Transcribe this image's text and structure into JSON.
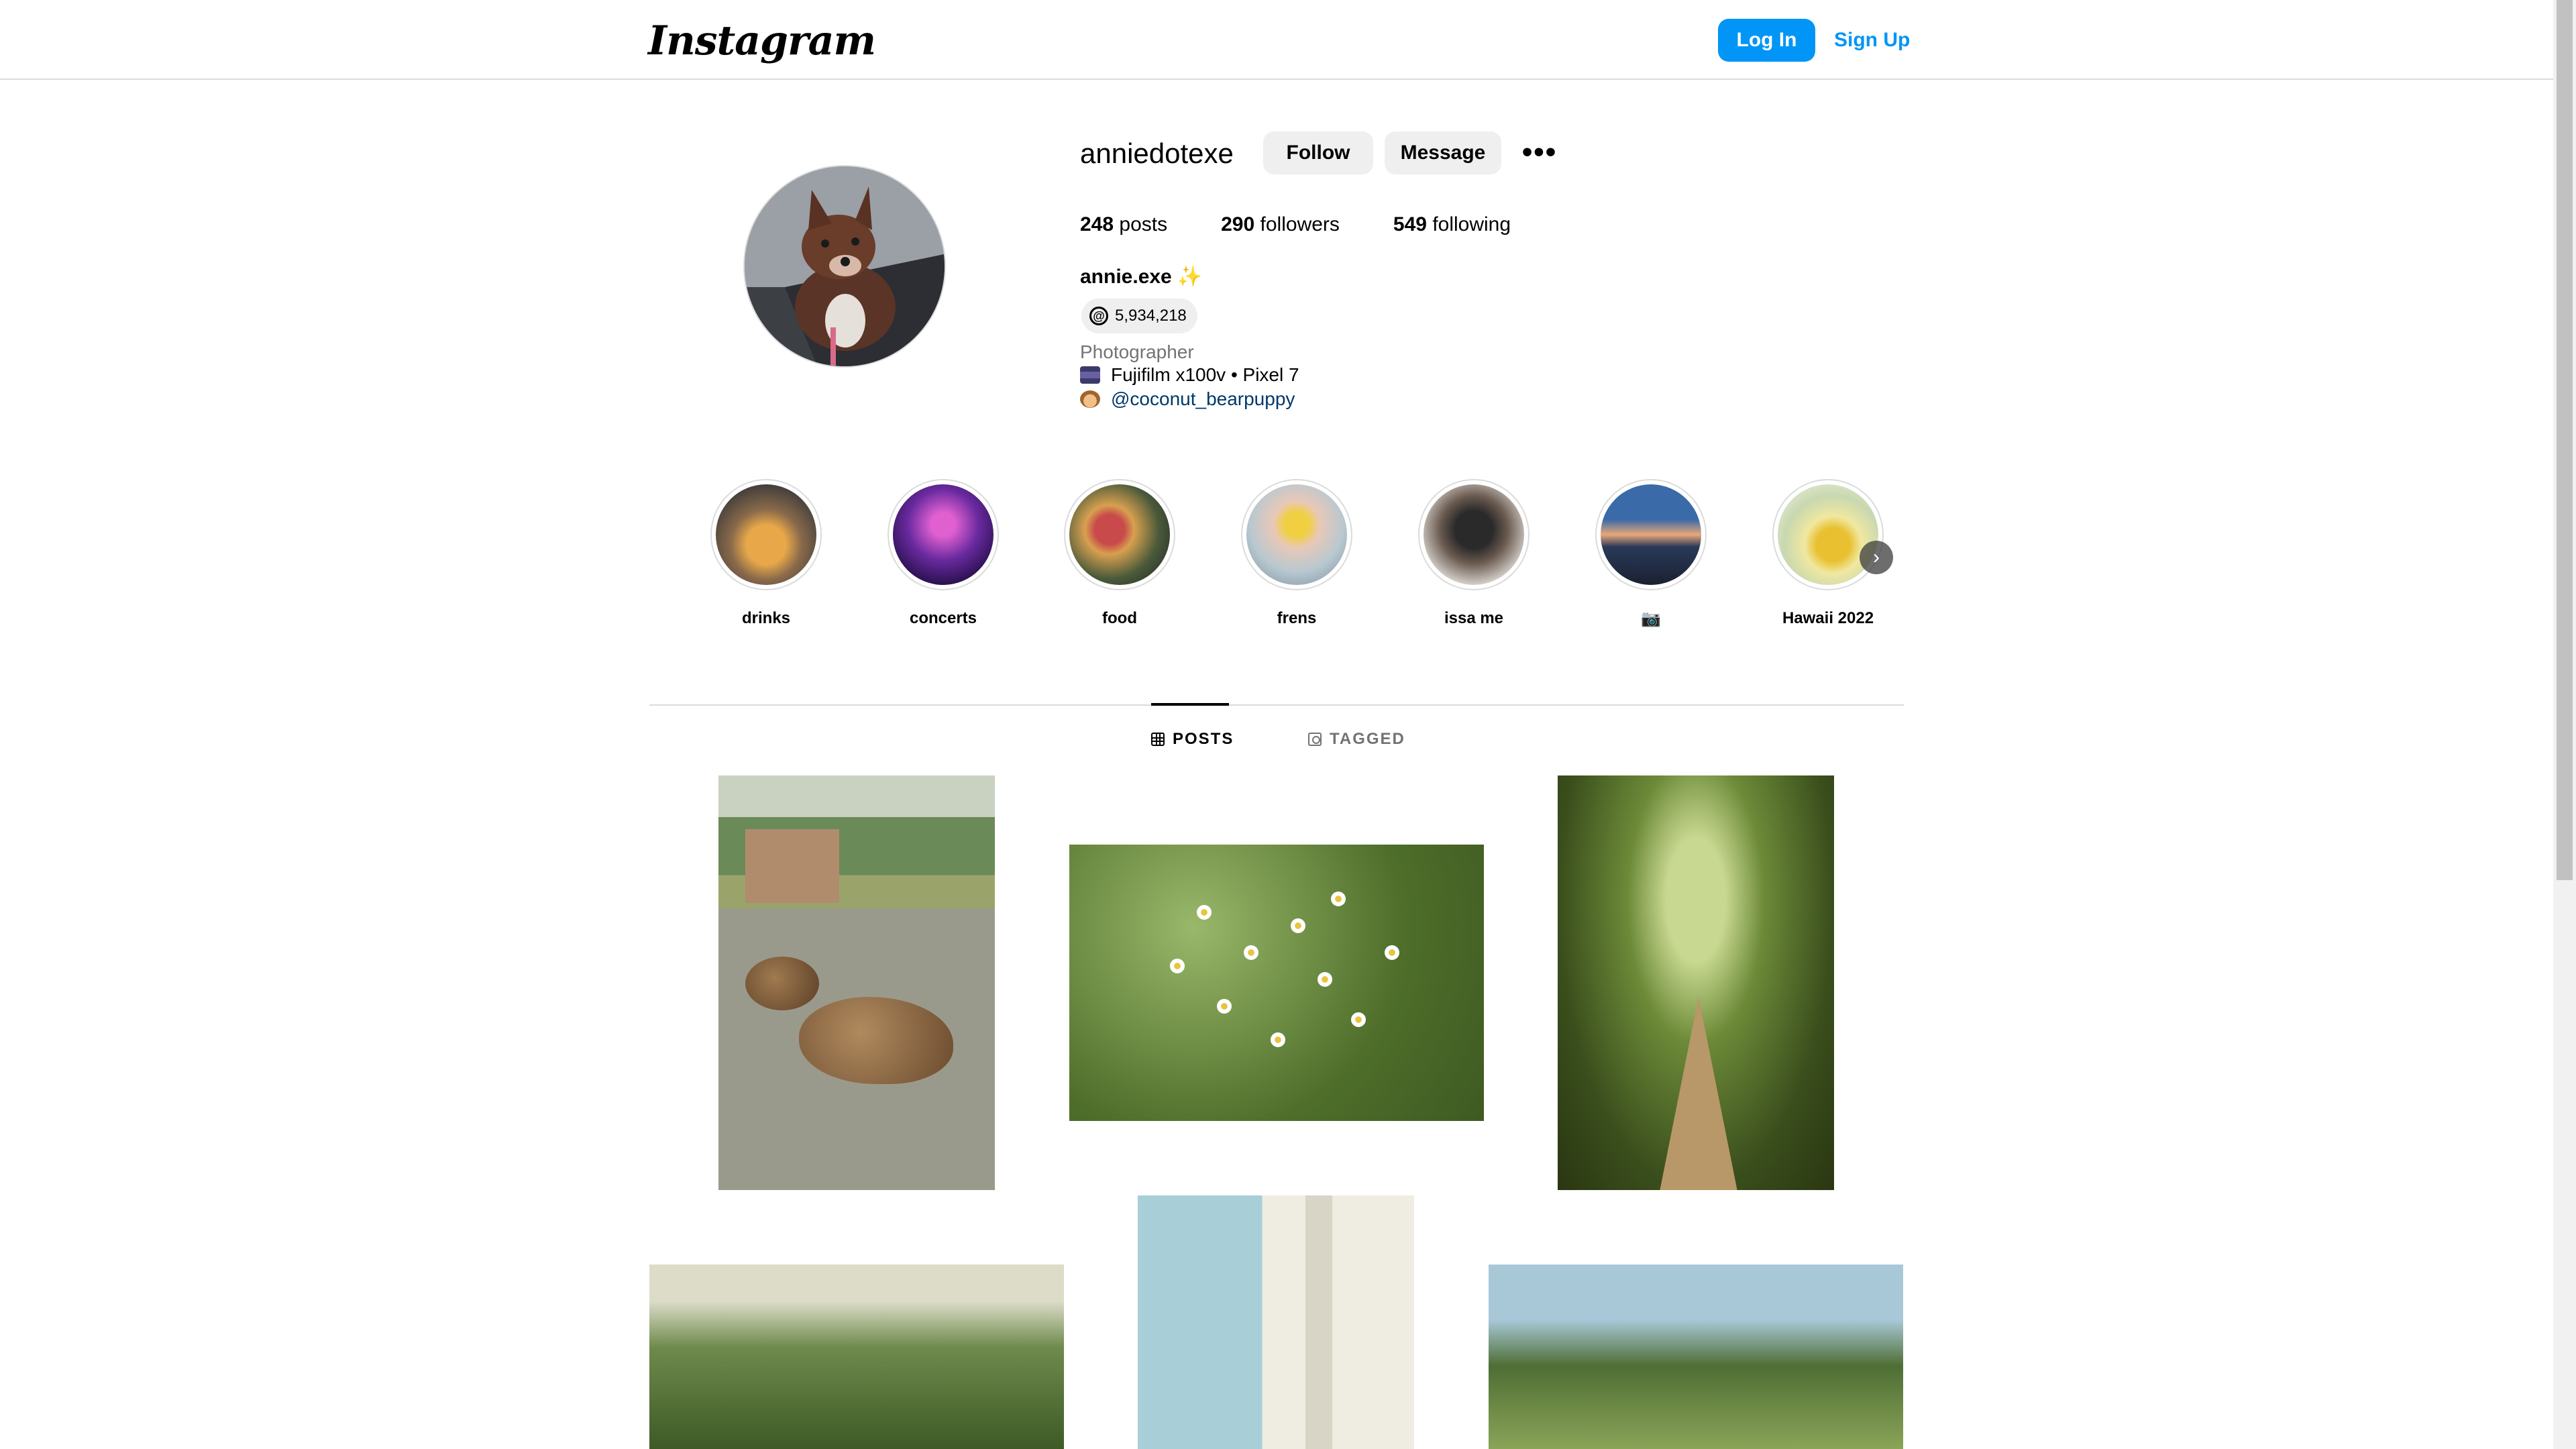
{
  "nav": {
    "logo_text": "Instagram",
    "login_label": "Log In",
    "signup_label": "Sign Up"
  },
  "profile": {
    "username": "anniedotexe",
    "follow_label": "Follow",
    "message_label": "Message",
    "more_label": "•••",
    "stats": {
      "posts_count": "248",
      "posts_label": "posts",
      "followers_count": "290",
      "followers_label": "followers",
      "following_count": "549",
      "following_label": "following"
    },
    "full_name": "annie.exe",
    "name_emoji": "✨",
    "threads_icon": "@",
    "threads_count": "5,934,218",
    "category": "Photographer",
    "bio_line_1": "Fujifilm x100v • Pixel 7",
    "bio_line_2_link": "@coconut_bearpuppy"
  },
  "highlights": [
    {
      "label": "drinks"
    },
    {
      "label": "concerts"
    },
    {
      "label": "food"
    },
    {
      "label": "frens"
    },
    {
      "label": "issa me"
    },
    {
      "label": "📷"
    },
    {
      "label": "Hawaii 2022"
    }
  ],
  "highlights_next_label": "›",
  "tabs": {
    "posts_label": "POSTS",
    "tagged_label": "TAGGED"
  },
  "colors": {
    "accent": "#0095f6",
    "link": "#00376b",
    "border": "#dbdbdb",
    "secondary_text": "#737373",
    "button_gray": "#efefef"
  },
  "icons": [
    "threads-icon",
    "more-options-icon",
    "grid-icon",
    "tag-icon",
    "chevron-right-icon",
    "camera-emoji-icon",
    "dog-emoji-icon"
  ]
}
